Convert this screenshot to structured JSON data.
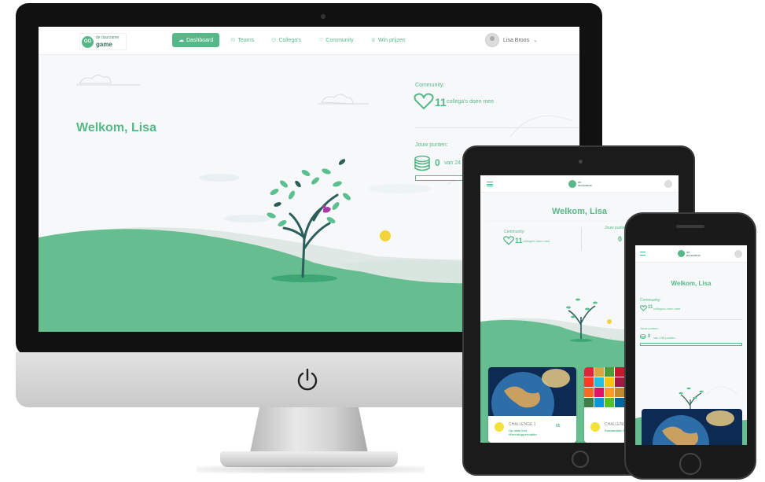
{
  "brand": {
    "logo_line1": "de duurzame",
    "logo_line2": "game",
    "accent_color": "#56b888"
  },
  "nav": {
    "items": [
      {
        "label": "Dashboard",
        "icon": "cloud-icon",
        "active": true
      },
      {
        "label": "Teams",
        "icon": "teams-icon",
        "active": false
      },
      {
        "label": "Collega's",
        "icon": "colleagues-icon",
        "active": false
      },
      {
        "label": "Community",
        "icon": "heart-icon",
        "active": false
      },
      {
        "label": "Win prijzen",
        "icon": "trophy-icon",
        "active": false
      }
    ]
  },
  "user": {
    "name": "Lisa Broos"
  },
  "dashboard": {
    "welcome": "Welkom, Lisa",
    "community_label": "Community:",
    "community_count": "11",
    "community_text": "collega's doen mee",
    "points_label": "Jouw punten:",
    "points_value": "0",
    "points_text": "van 245 punten",
    "points_text_short": "van 24",
    "progress": 0
  },
  "tablet": {
    "welcome": "Welkom, Lisa",
    "community_label": "Community:",
    "community_count": "11",
    "community_text": "collega's doen mee",
    "points_label": "Jouw punten:",
    "points_value": "0",
    "cards": [
      {
        "label": "CHALLENGE 1",
        "title": "Op naar een Wereldoppervlakte",
        "number": "65"
      },
      {
        "label": "CHALLENGE",
        "title": "Sustainable Development",
        "number": ""
      }
    ]
  },
  "phone": {
    "welcome": "Welkom, Lisa",
    "community_label": "Community:",
    "community_count": "11",
    "community_text": "collega's doen mee",
    "points_label": "Jouw punten:",
    "points_value": "0",
    "points_text": "van 245 punten"
  }
}
